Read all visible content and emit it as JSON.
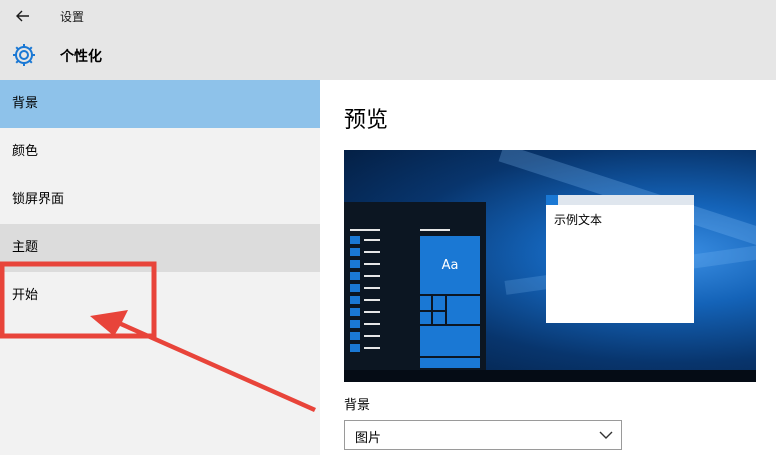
{
  "window": {
    "title": "设置",
    "back_icon": "arrow-left-icon"
  },
  "header": {
    "icon": "gear-icon",
    "title": "个性化"
  },
  "sidebar": {
    "items": [
      {
        "label": "背景",
        "state": "selected"
      },
      {
        "label": "颜色",
        "state": "normal"
      },
      {
        "label": "锁屏界面",
        "state": "normal"
      },
      {
        "label": "主题",
        "state": "hover"
      },
      {
        "label": "开始",
        "state": "normal"
      }
    ]
  },
  "main": {
    "section_title": "预览",
    "preview": {
      "tile_label": "Aa",
      "sample_window_text": "示例文本"
    },
    "background_label": "背景",
    "background_dropdown": {
      "value": "图片",
      "icon": "chevron-down-icon"
    }
  },
  "colors": {
    "accent": "#1a78d4",
    "selected_nav": "#8ec2ea",
    "annotation_red": "#e8443a"
  }
}
